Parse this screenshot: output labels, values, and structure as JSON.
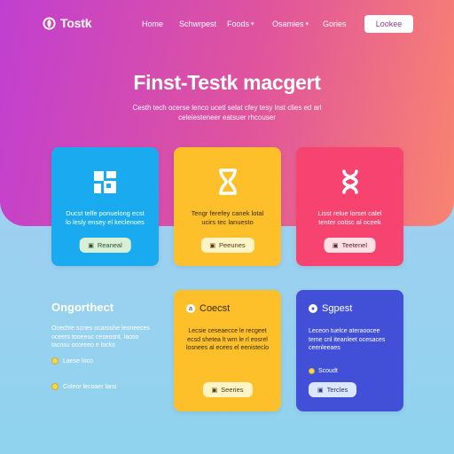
{
  "brand": {
    "name": "Tostk",
    "logo_icon": "leaf-logo-icon"
  },
  "nav": {
    "links": [
      {
        "label": "Home",
        "dropdown": false
      },
      {
        "label": "Schwrpest",
        "dropdown": false
      },
      {
        "label": "Foods",
        "dropdown": true
      },
      {
        "label": "Osamies",
        "dropdown": true
      },
      {
        "label": "Gories",
        "dropdown": false
      }
    ],
    "cta": "Lookee"
  },
  "hero": {
    "title": "Finst-Testk macgert",
    "subtitle": "Cesth tech ocerse lenco ucetl selat cfey tesy lnst clies  ed arl celeiesteneer eatsuer rhcouser"
  },
  "feature_cards": [
    {
      "icon": "puzzle-icon",
      "description": "Ducst telfe ponuelong ecst lo lesly ensey el keclenoes",
      "button": "Reaneal",
      "color": "#19aaf0"
    },
    {
      "icon": "hourglass-icon",
      "description": "Tengr ferefey canek lotal ucirs tec lanuesto",
      "button": "Peeunes",
      "color": "#fdc02a"
    },
    {
      "icon": "loop-icon",
      "description": "Lisst relue lorset calel tenter cotisc al oceek",
      "button": "Teetenel",
      "color": "#f6436f"
    }
  ],
  "left_section": {
    "title": "Ongorthect",
    "description": "Ocechte scnes ocaroshe leoneeces oceers tooeeuc ceseosnt, laoso tacnsu ocoreeo e locks",
    "items": [
      "Laese loco",
      "Coleor lecoaer lans"
    ]
  },
  "info_cards": [
    {
      "title": "Coecst",
      "head_icon": "info-icon",
      "body": "Lecsie ceseaecce le recgeet ecsd shetea lt wrn le rl eosrel losnees al ecees el eenisteclo",
      "button": "Seeries",
      "color": "#fdc02a"
    },
    {
      "title": "Sgpest",
      "head_icon": "info-icon",
      "body": "Leceon tuelce ateraoocee teme cnl iteanleet ocesaces ceenleeaes",
      "feature": "Scoudt",
      "button": "Tercles",
      "color": "#4150d6"
    }
  ]
}
